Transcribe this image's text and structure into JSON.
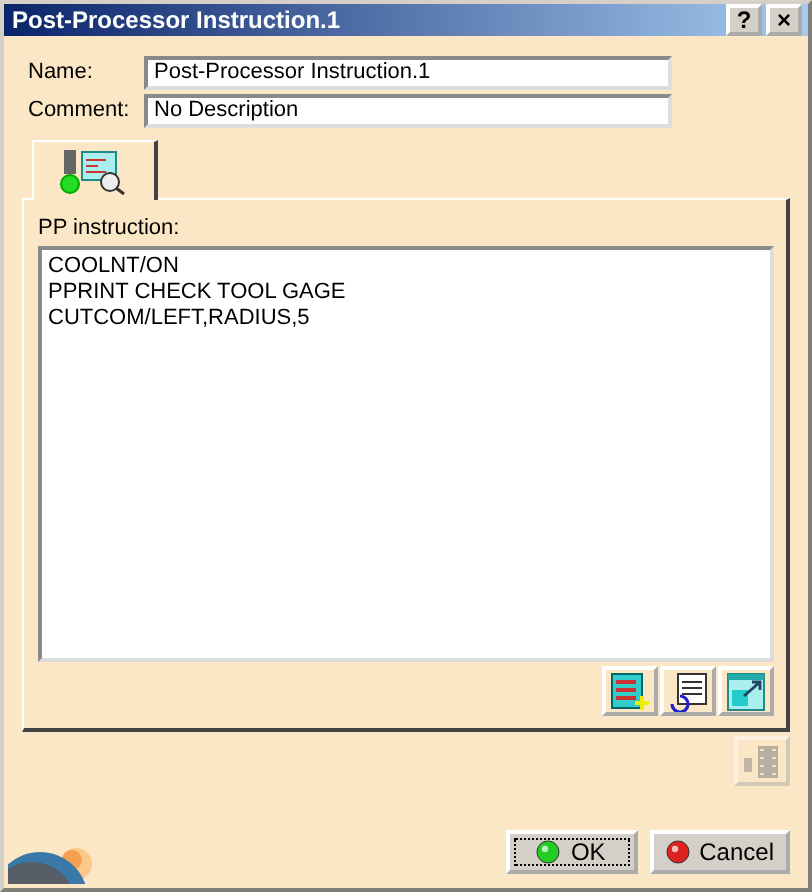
{
  "window": {
    "title": "Post-Processor Instruction.1",
    "title_buttons": [
      "?",
      "×"
    ]
  },
  "fields": [
    {
      "label": "Name:",
      "value": "Post-Processor Instruction.1"
    },
    {
      "label": "Comment:",
      "value": "No Description"
    }
  ],
  "tabs": [
    {
      "selected": true
    }
  ],
  "instruction": {
    "label": "PP instruction:",
    "lines": [
      "COOLNT/ON",
      "PPRINT CHECK TOOL GAGE",
      "CUTCOM/LEFT,RADIUS,5"
    ]
  },
  "tools": [
    {
      "kind": "add"
    },
    {
      "kind": "edit"
    },
    {
      "kind": "export"
    }
  ],
  "side_tool": {
    "disabled": true
  },
  "buttons": [
    {
      "label": "OK",
      "kind": "ok",
      "focused": true
    },
    {
      "label": "Cancel",
      "kind": "cancel",
      "focused": false
    }
  ]
}
